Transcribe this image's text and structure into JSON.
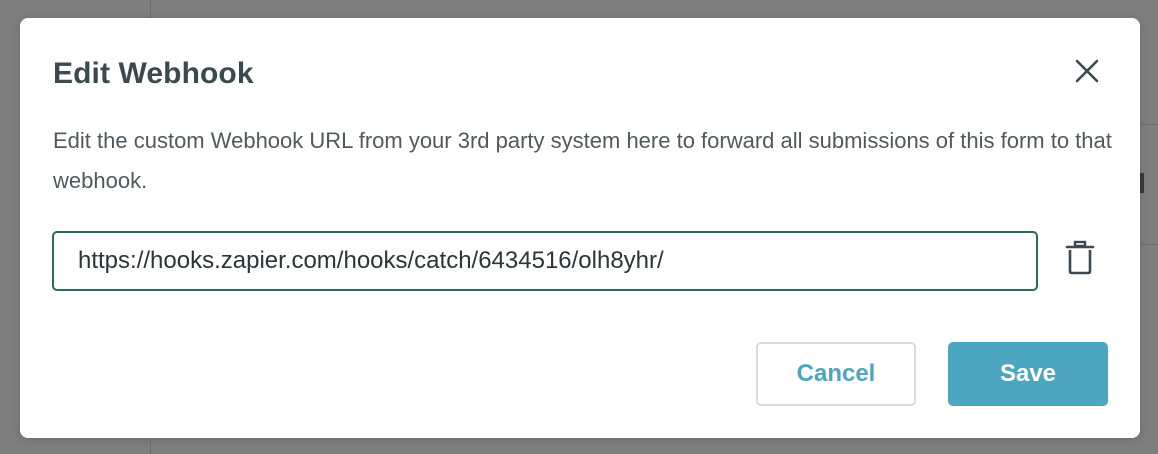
{
  "dialog": {
    "title": "Edit Webhook",
    "description": "Edit the custom Webhook URL from your 3rd party system here to forward all submissions of this form to that webhook.",
    "webhook_url": "https://hooks.zapier.com/hooks/catch/6434516/olh8yhr/",
    "cancel_label": "Cancel",
    "save_label": "Save",
    "icons": {
      "close": "close-icon",
      "delete": "trash-icon"
    }
  },
  "colors": {
    "title": "#3b4a4f",
    "description": "#505a5e",
    "input_border": "#2d6a58",
    "accent": "#4da6bf",
    "cancel_border": "#d6dbdc",
    "overlay": "#7e7e7e",
    "icon": "#3b4a4f"
  }
}
